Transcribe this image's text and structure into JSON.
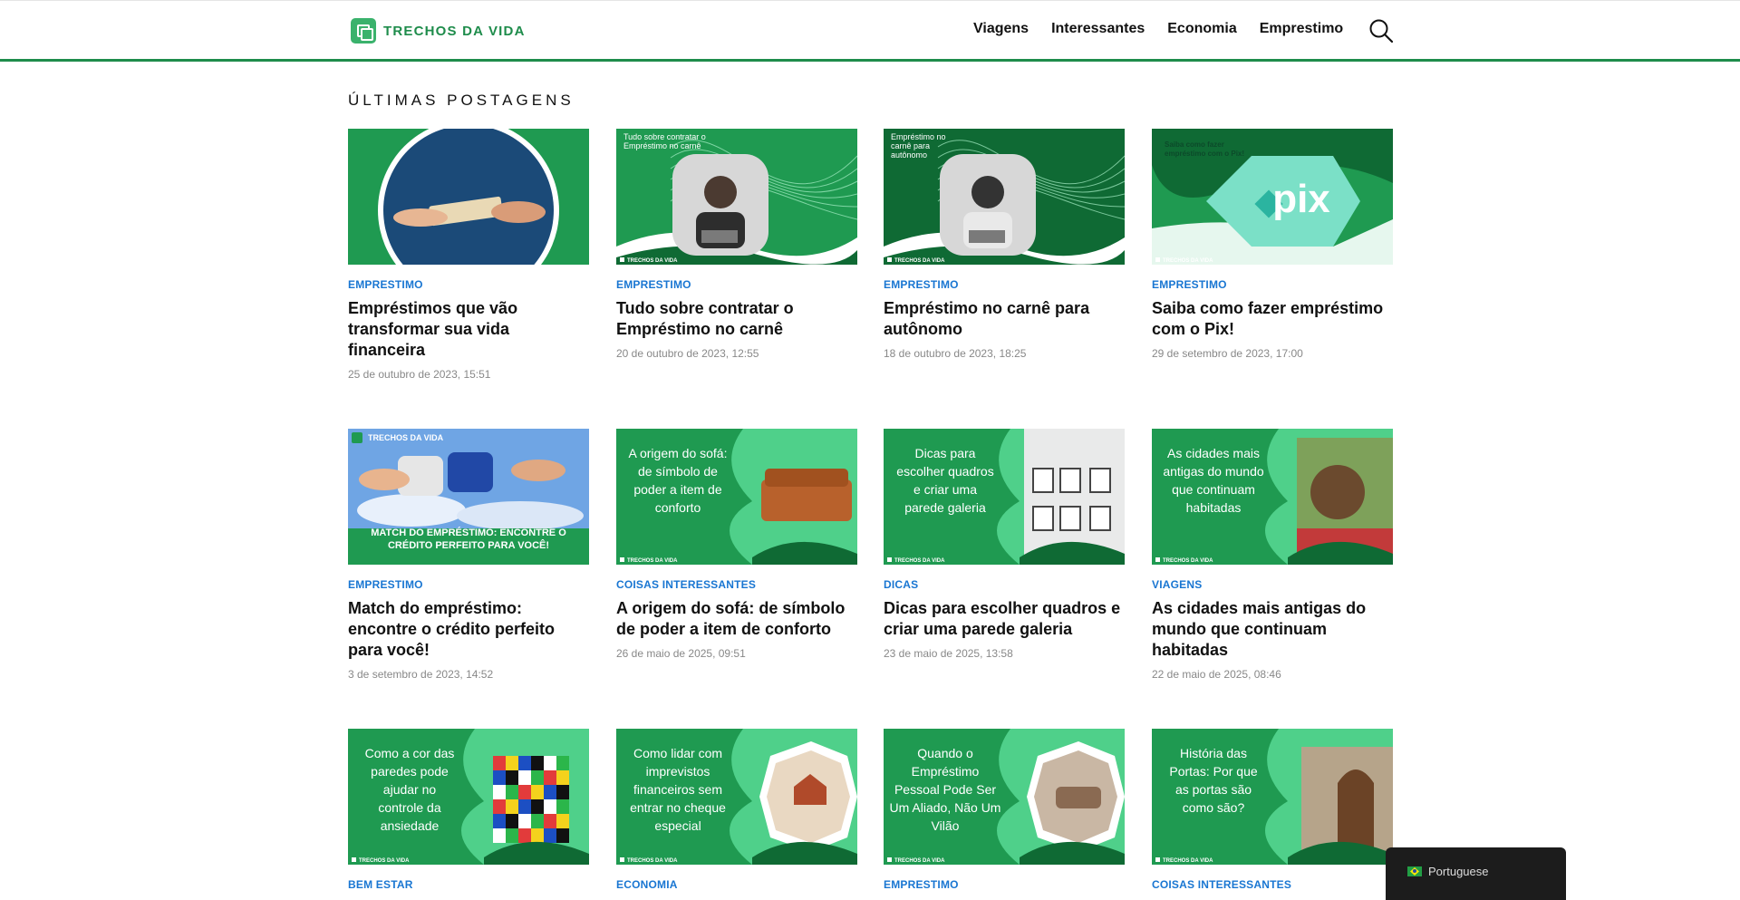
{
  "header": {
    "logo_text": "TRECHOS DA VIDA",
    "nav": [
      "Viagens",
      "Interessantes",
      "Economia",
      "Emprestimo"
    ]
  },
  "section_title": "ÚLTIMAS POSTAGENS",
  "posts": [
    {
      "category": "EMPRESTIMO",
      "title": "Empréstimos que vão transformar sua vida financeira",
      "date": "25 de outubro de 2023, 15:51",
      "thumb_text": ""
    },
    {
      "category": "EMPRESTIMO",
      "title": "Tudo sobre contratar o Empréstimo no carnê",
      "date": "20 de outubro de 2023, 12:55",
      "thumb_text": "Tudo sobre contratar o Empréstimo no carnê"
    },
    {
      "category": "EMPRESTIMO",
      "title": "Empréstimo no carnê para autônomo",
      "date": "18 de outubro de 2023, 18:25",
      "thumb_text": "Empréstimo no carnê para autônomo"
    },
    {
      "category": "EMPRESTIMO",
      "title": "Saiba como fazer empréstimo com o Pix!",
      "date": "29 de setembro de 2023, 17:00",
      "thumb_text": "Saiba como fazer empréstimo com o Pix!"
    },
    {
      "category": "EMPRESTIMO",
      "title": "Match do empréstimo: encontre o crédito perfeito para você!",
      "date": "3 de setembro de 2023, 14:52",
      "thumb_text": "MATCH DO EMPRÉSTIMO: ENCONTRE O CRÉDITO PERFEITO PARA VOCÊ!"
    },
    {
      "category": "COISAS INTERESSANTES",
      "title": "A origem do sofá: de símbolo de poder a item de conforto",
      "date": "26 de maio de 2025, 09:51",
      "thumb_text": "A origem do sofá: de símbolo de poder a item de conforto"
    },
    {
      "category": "DICAS",
      "title": "Dicas para escolher quadros e criar uma parede galeria",
      "date": "23 de maio de 2025, 13:58",
      "thumb_text": "Dicas para escolher quadros e criar uma parede galeria"
    },
    {
      "category": "VIAGENS",
      "title": "As cidades mais antigas do mundo que continuam habitadas",
      "date": "22 de maio de 2025, 08:46",
      "thumb_text": "As cidades mais antigas do mundo que continuam habitadas"
    },
    {
      "category": "BEM ESTAR",
      "title": "",
      "date": "",
      "thumb_text": "Como a cor das paredes pode ajudar no controle da ansiedade"
    },
    {
      "category": "ECONOMIA",
      "title": "",
      "date": "",
      "thumb_text": "Como lidar com imprevistos financeiros sem entrar no cheque especial"
    },
    {
      "category": "EMPRESTIMO",
      "title": "",
      "date": "",
      "thumb_text": "Quando o Empréstimo Pessoal Pode Ser Um Aliado, Não Um Vilão"
    },
    {
      "category": "COISAS INTERESSANTES",
      "title": "",
      "date": "",
      "thumb_text": "História das Portas: Por que as portas são como são?"
    }
  ],
  "thumb_brand": "TRECHOS DA VIDA",
  "pix_label": "pix",
  "language": "Portuguese",
  "colors": {
    "brand_green": "#1e8c4b",
    "category_blue": "#1976d2"
  }
}
